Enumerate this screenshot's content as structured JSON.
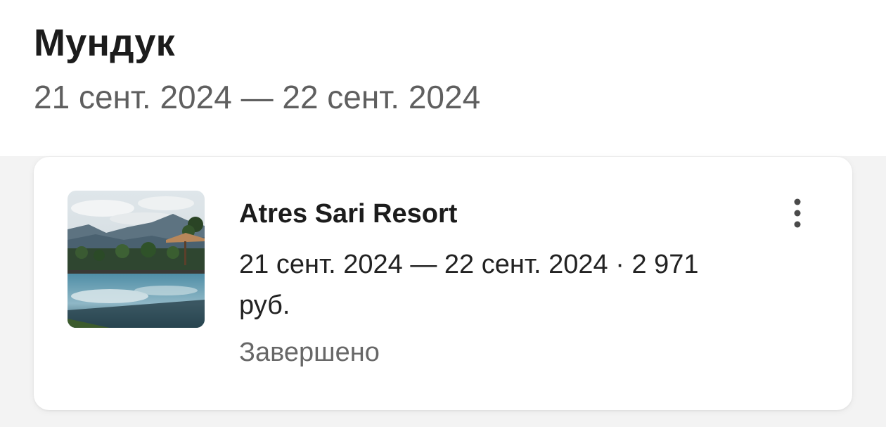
{
  "trip": {
    "title": "Мундук",
    "dates": "21 сент. 2024 — 22 сент. 2024"
  },
  "booking": {
    "hotel_name": "Atres Sari Resort",
    "details": "21 сент. 2024 — 22 сент. 2024 · 2 971 руб.",
    "status": "Завершено",
    "menu_icon": "more-vertical-icon"
  }
}
